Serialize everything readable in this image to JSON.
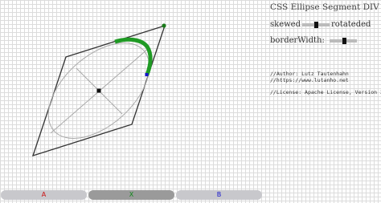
{
  "title": "CSS Ellipse Segment DIV",
  "controls": {
    "skewed_label": "skewed",
    "rotated_label": "rotateded",
    "border_width_label": "borderWidth:",
    "skewed_value": 0.5,
    "border_width_value": 0.55
  },
  "info": {
    "author": "//Author: Lutz Tautenhahn",
    "url": "//https://www.lutanho.net",
    "license": "//License: Apache License, Version 2.0"
  },
  "tabs": [
    {
      "label": "A",
      "color": "#cc1111"
    },
    {
      "label": "X",
      "color": "#11881a"
    },
    {
      "label": "B",
      "color": "#1414cc"
    }
  ],
  "colors": {
    "outline": "#333333",
    "ellipse": "#aaaaaa",
    "segment": "#1f9a24",
    "handle_green": "#1a7a1a",
    "handle_blue": "#1414cc"
  }
}
